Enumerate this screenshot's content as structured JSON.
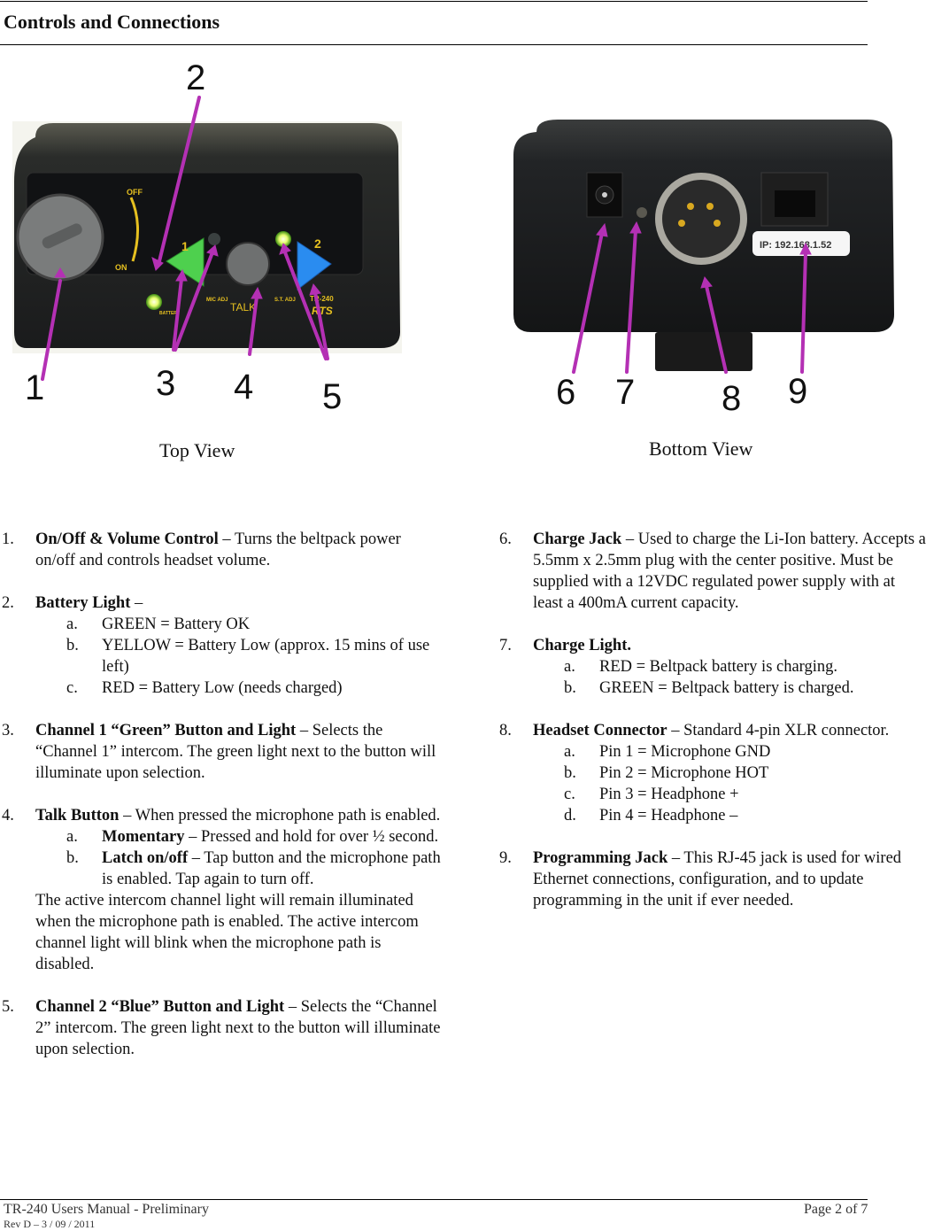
{
  "header": {
    "title": "Controls and Connections"
  },
  "figures": {
    "top": {
      "caption": "Top View",
      "callouts": [
        "1",
        "2",
        "3",
        "4",
        "5"
      ],
      "device_labels": {
        "off": "OFF",
        "on": "ON",
        "battery": "BATTERY",
        "mic_adj": "MIC ADJ",
        "talk": "TALK",
        "st_adj": "S.T. ADJ",
        "ch1": "1",
        "ch2": "2",
        "model": "TR-240",
        "brand": "RTS"
      }
    },
    "bottom": {
      "caption": "Bottom View",
      "callouts": [
        "6",
        "7",
        "8",
        "9"
      ],
      "ip_label": "IP: 192.168.1.52"
    },
    "arrow_color": "#b430b4"
  },
  "left_items": [
    {
      "num": "1.",
      "lead": "On/Off & Volume Control",
      "text": " – Turns the beltpack power on/off and controls headset volume."
    },
    {
      "num": "2.",
      "lead": "Battery Light",
      "text": " –",
      "sub": [
        {
          "letter": "a.",
          "text": "GREEN = Battery OK"
        },
        {
          "letter": "b.",
          "text": "YELLOW = Battery Low (approx. 15 mins of use left)"
        },
        {
          "letter": "c.",
          "text": "RED =  Battery Low (needs charged)"
        }
      ]
    },
    {
      "num": "3.",
      "lead": "Channel 1 “Green” Button and Light",
      "text": " – Selects the “Channel 1” intercom.  The green light next to the button will illuminate upon selection."
    },
    {
      "num": "4.",
      "lead": "Talk Button",
      "text": " – When pressed the microphone path is enabled.",
      "sub": [
        {
          "letter": "a.",
          "lead": "Momentary",
          "text": " – Pressed and hold for over ½ second."
        },
        {
          "letter": "b.",
          "lead": "Latch on/off",
          "text": " – Tap button and the microphone path is enabled. Tap again to turn off."
        }
      ],
      "after": "The active intercom channel light will remain illuminated when the microphone path is enabled.  The active intercom channel light will blink when the microphone path is disabled."
    },
    {
      "num": "5.",
      "lead": "Channel 2 “Blue” Button and Light",
      "text": " – Selects the “Channel 2” intercom.  The green light next to the button will illuminate upon selection."
    }
  ],
  "right_items": [
    {
      "num": "6.",
      "lead": "Charge Jack",
      "text": " – Used to charge the Li-Ion battery.  Accepts a 5.5mm x 2.5mm plug with the center positive.  Must be supplied with a 12VDC regulated power supply with at least a 400mA current capacity."
    },
    {
      "num": "7.",
      "lead": "Charge Light",
      "text": ".",
      "sub": [
        {
          "letter": "a.",
          "text": "RED = Beltpack battery is charging."
        },
        {
          "letter": "b.",
          "text": "GREEN = Beltpack battery is charged."
        }
      ]
    },
    {
      "num": "8.",
      "lead": "Headset Connector",
      "text": " – Standard 4-pin XLR connector.",
      "sub": [
        {
          "letter": "a.",
          "text": "Pin 1 = Microphone GND"
        },
        {
          "letter": "b.",
          "text": "Pin 2 = Microphone HOT"
        },
        {
          "letter": "c.",
          "text": "Pin 3 = Headphone +"
        },
        {
          "letter": "d.",
          "text": "Pin 4 = Headphone –"
        }
      ]
    },
    {
      "num": "9.",
      "lead": "Programming Jack",
      "text": " – This RJ-45 jack is used for wired Ethernet connections, configuration, and to update programming in the unit if ever needed."
    }
  ],
  "footer": {
    "doc_title": "TR-240 Users Manual - Preliminary",
    "revision": "Rev D – 3 / 09 / 2011",
    "page": "Page 2 of 7"
  }
}
